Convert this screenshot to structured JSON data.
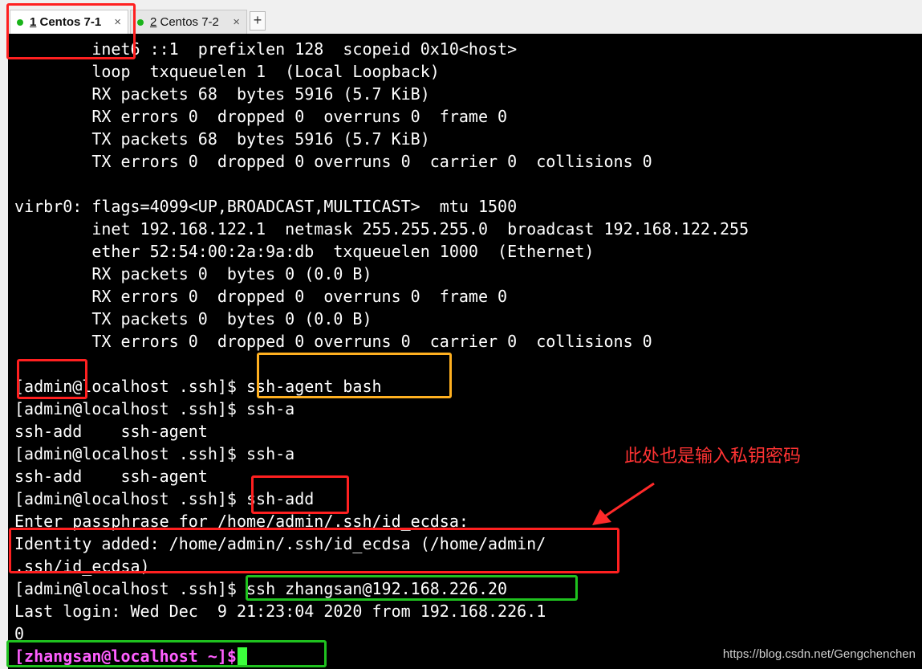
{
  "tabs": [
    {
      "num": "1",
      "title": " Centos 7-1",
      "close": "×",
      "status_color": "#19b319"
    },
    {
      "num": "2",
      "title": " Centos 7-2",
      "close": "×",
      "status_color": "#19b319"
    }
  ],
  "add_tab": "+",
  "terminal": {
    "lines": [
      "        inet6 ::1  prefixlen 128  scopeid 0x10<host>",
      "        loop  txqueuelen 1  (Local Loopback)",
      "        RX packets 68  bytes 5916 (5.7 KiB)",
      "        RX errors 0  dropped 0  overruns 0  frame 0",
      "        TX packets 68  bytes 5916 (5.7 KiB)",
      "        TX errors 0  dropped 0 overruns 0  carrier 0  collisions 0",
      "",
      "virbr0: flags=4099<UP,BROADCAST,MULTICAST>  mtu 1500",
      "        inet 192.168.122.1  netmask 255.255.255.0  broadcast 192.168.122.255",
      "        ether 52:54:00:2a:9a:db  txqueuelen 1000  (Ethernet)",
      "        RX packets 0  bytes 0 (0.0 B)",
      "        RX errors 0  dropped 0  overruns 0  frame 0",
      "        TX packets 0  bytes 0 (0.0 B)",
      "        TX errors 0  dropped 0 overruns 0  carrier 0  collisions 0",
      "",
      "[admin@localhost .ssh]$ ssh-agent bash",
      "[admin@localhost .ssh]$ ssh-a",
      "ssh-add    ssh-agent",
      "[admin@localhost .ssh]$ ssh-a",
      "ssh-add    ssh-agent",
      "[admin@localhost .ssh]$ ssh-add",
      "Enter passphrase for /home/admin/.ssh/id_ecdsa:",
      "Identity added: /home/admin/.ssh/id_ecdsa (/home/admin/",
      ".ssh/id_ecdsa)",
      "[admin@localhost .ssh]$ ssh zhangsan@192.168.226.20",
      "Last login: Wed Dec  9 21:23:04 2020 from 192.168.226.1",
      "0"
    ],
    "final_prompt": "[zhangsan@localhost ~]$"
  },
  "annotation": {
    "note": "此处也是输入私钥密码",
    "color": "#ff3333"
  },
  "watermark": "https://blog.csdn.net/Gengchenchen"
}
